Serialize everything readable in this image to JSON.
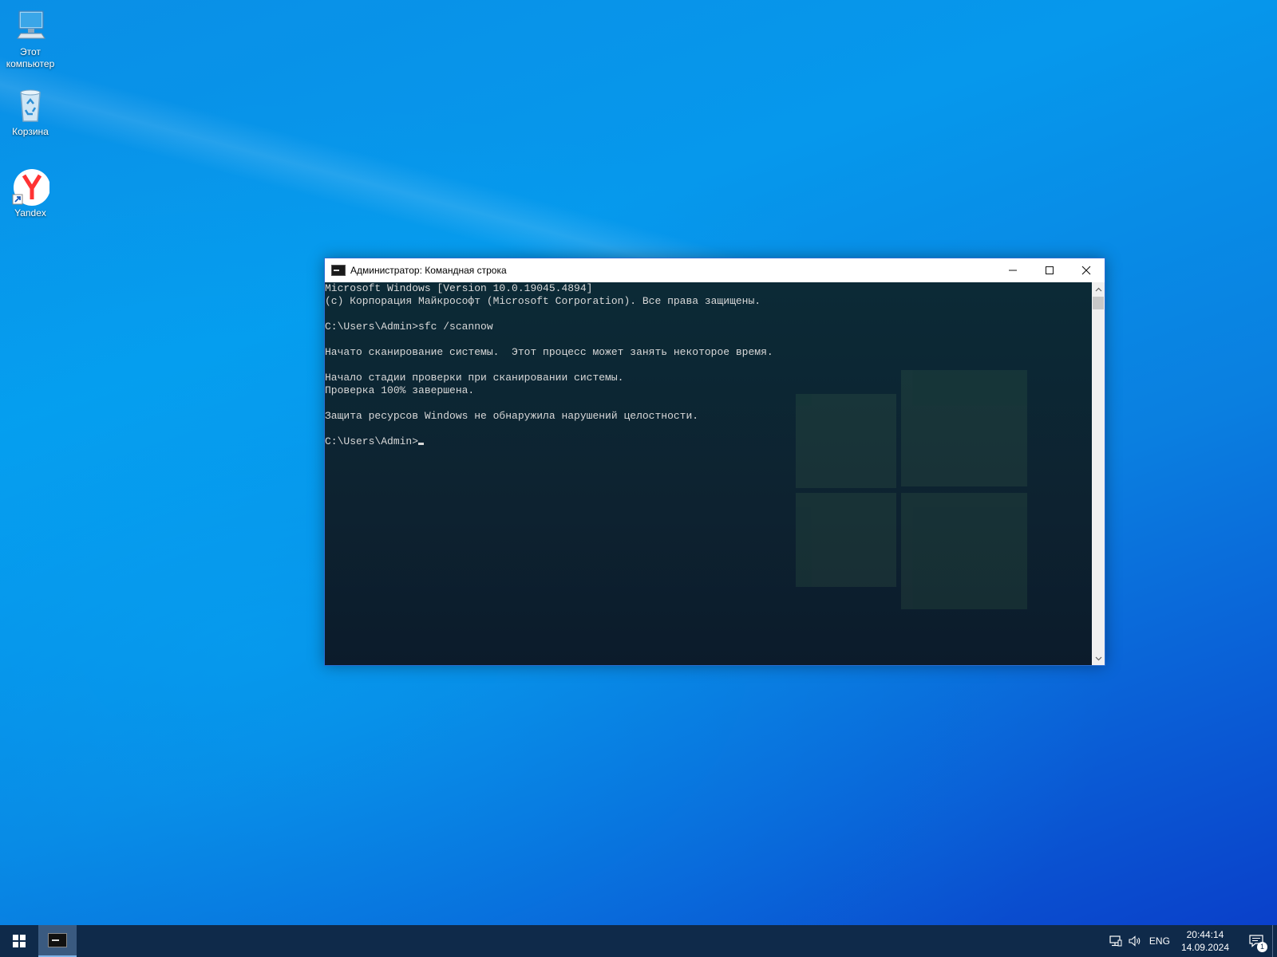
{
  "desktop": {
    "icons": [
      {
        "label_line1": "Этот",
        "label_line2": "компьютер",
        "icon": "computer-icon"
      },
      {
        "label_line1": "Корзина",
        "label_line2": "",
        "icon": "recycle-bin-icon"
      },
      {
        "label_line1": "Yandex",
        "label_line2": "",
        "icon": "yandex-browser-icon"
      }
    ]
  },
  "window": {
    "title": "Администратор: Командная строка",
    "minimize": "—",
    "maximize": "☐",
    "close": "✕",
    "console_lines": [
      "Microsoft Windows [Version 10.0.19045.4894]",
      "(c) Корпорация Майкрософт (Microsoft Corporation). Все права защищены.",
      "",
      "C:\\Users\\Admin>sfc /scannow",
      "",
      "Начато сканирование системы.  Этот процесс может занять некоторое время.",
      "",
      "Начало стадии проверки при сканировании системы.",
      "Проверка 100% завершена.",
      "",
      "Защита ресурсов Windows не обнаружила нарушений целостности.",
      "",
      "C:\\Users\\Admin>"
    ]
  },
  "taskbar": {
    "language": "ENG",
    "time": "20:44:14",
    "date": "14.09.2024",
    "notification_count": "1"
  },
  "colors": {
    "console_text": "#d8d8d8",
    "taskbar": "#0f2a4a",
    "window_border": "#2b6fd4"
  }
}
